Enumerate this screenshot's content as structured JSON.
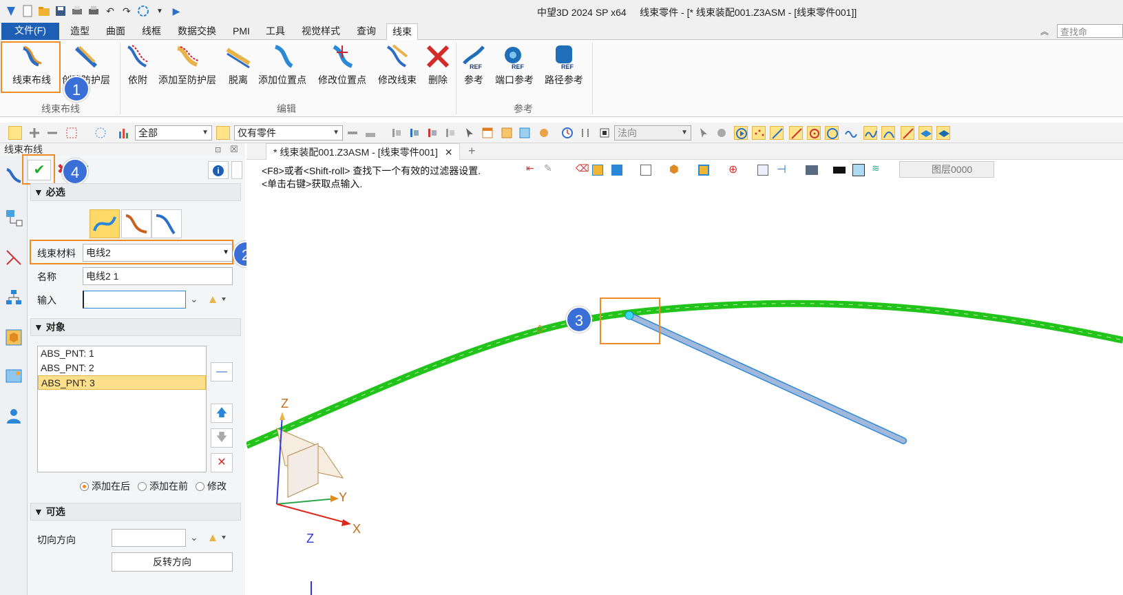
{
  "app": {
    "title": "中望3D 2024 SP x64",
    "doc_title": "线束零件 - [* 线束装配001.Z3ASM - [线束零件001]]"
  },
  "menu": {
    "file": "文件(F)",
    "tabs": [
      "造型",
      "曲面",
      "线框",
      "数据交换",
      "PMI",
      "工具",
      "视觉样式",
      "查询",
      "线束"
    ],
    "search_placeholder": "查找命"
  },
  "ribbon": {
    "buttons": [
      {
        "label": "线束布线",
        "icon": "harness-route-icon"
      },
      {
        "label": "创建防护层",
        "icon": "create-sheath-icon"
      },
      {
        "label": "依附",
        "icon": "attach-icon"
      },
      {
        "label": "添加至防护层",
        "icon": "add-to-sheath-icon"
      },
      {
        "label": "脱离",
        "icon": "detach-icon"
      },
      {
        "label": "添加位置点",
        "icon": "add-point-icon"
      },
      {
        "label": "修改位置点",
        "icon": "modify-point-icon"
      },
      {
        "label": "修改线束",
        "icon": "modify-harness-icon"
      },
      {
        "label": "删除",
        "icon": "delete-icon"
      },
      {
        "label": "参考",
        "icon": "reference-icon"
      },
      {
        "label": "端口参考",
        "icon": "port-reference-icon"
      },
      {
        "label": "路径参考",
        "icon": "path-reference-icon"
      }
    ],
    "groups": [
      "线束布线",
      "编辑",
      "参考"
    ]
  },
  "toolbar": {
    "filter_value": "全部",
    "scope_value": "仅有零件",
    "direction_value": "法向"
  },
  "panel": {
    "title": "线束布线",
    "section_required": "必选",
    "material_label": "线束材料",
    "material_value": "电线2",
    "name_label": "名称",
    "name_value": "电线2 1",
    "input_label": "输入",
    "input_value": "",
    "section_objects": "对象",
    "objects": [
      "ABS_PNT: 1",
      "ABS_PNT: 2",
      "ABS_PNT: 3"
    ],
    "selected_object": "ABS_PNT: 3",
    "radio_after": "添加在后",
    "radio_before": "添加在前",
    "radio_modify": "修改",
    "section_optional": "可选",
    "tangent_label": "切向方向",
    "reverse_button": "反转方向"
  },
  "viewport": {
    "doc_tab": "* 线束装配001.Z3ASM - [线束零件001]",
    "hint_line1": "<F8>或者<Shift-roll> 查找下一个有效的过滤器设置.",
    "hint_line2": "<单击右键>获取点输入.",
    "layer": "图层0000",
    "axis_x": "X",
    "axis_y": "Y",
    "axis_z": "Z"
  },
  "annotations": {
    "badges": [
      "1",
      "2",
      "3",
      "4"
    ],
    "highlight_color": "#f08a24",
    "badge_color": "#3b6fd8"
  },
  "colors": {
    "harness_green": "#22c41c",
    "wire_blue": "#9fb8dc",
    "file_tab": "#1d5fb5"
  }
}
